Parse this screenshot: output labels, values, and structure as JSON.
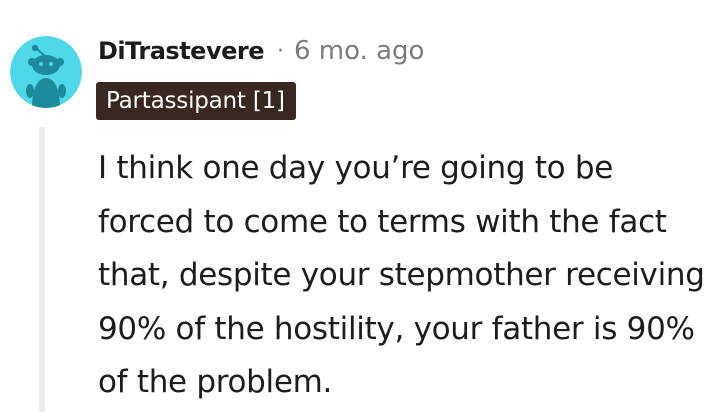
{
  "comment": {
    "username": "DiTrastevere",
    "separator": "·",
    "timestamp": "6 mo. ago",
    "flair": "Partassipant [1]",
    "text": "I think one day you’re going to be forced to come to terms with the fact that, despite your stepmother receiving 90% of the hostility, your father is 90% of the problem.",
    "avatar_icon": "snoo-avatar-icon"
  },
  "colors": {
    "avatar_background": "#4fd9e8",
    "avatar_figure": "#1c8a9a",
    "flair_background": "#3a2722",
    "flair_text": "#ffffff",
    "username": "#1c1c1c",
    "meta_text": "#7c7c7c",
    "thread_line": "#e9ebec"
  }
}
